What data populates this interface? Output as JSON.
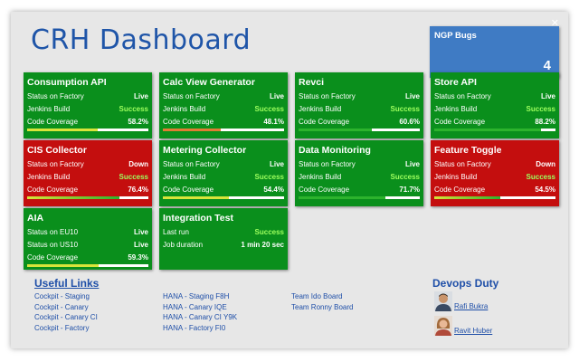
{
  "title": "CRH Dashboard",
  "close_label": "✕",
  "ngp_bugs": {
    "label": "NGP Bugs",
    "count": "4"
  },
  "cards": [
    {
      "title": "Consumption API",
      "color": "green",
      "rows": [
        [
          "Status on Factory",
          "Live"
        ],
        [
          "Jenkins Build",
          "Success"
        ],
        [
          "Code Coverage",
          "58.2%"
        ]
      ],
      "coverage": 58.2
    },
    {
      "title": "Calc View Generator",
      "color": "green",
      "rows": [
        [
          "Status on Factory",
          "Live"
        ],
        [
          "Jenkins Build",
          "Success"
        ],
        [
          "Code Coverage",
          "48.1%"
        ]
      ],
      "coverage": 48.1
    },
    {
      "title": "Revci",
      "color": "green",
      "rows": [
        [
          "Status on Factory",
          "Live"
        ],
        [
          "Jenkins Build",
          "Success"
        ],
        [
          "Code Coverage",
          "60.6%"
        ]
      ],
      "coverage": 60.6
    },
    {
      "title": "Store API",
      "color": "green",
      "rows": [
        [
          "Status on Factory",
          "Live"
        ],
        [
          "Jenkins Build",
          "Success"
        ],
        [
          "Code Coverage",
          "88.2%"
        ]
      ],
      "coverage": 88.2
    },
    {
      "title": "CIS Collector",
      "color": "red",
      "rows": [
        [
          "Status on Factory",
          "Down"
        ],
        [
          "Jenkins Build",
          "Success"
        ],
        [
          "Code Coverage",
          "76.4%"
        ]
      ],
      "coverage": 76.4
    },
    {
      "title": "Metering Collector",
      "color": "green",
      "rows": [
        [
          "Status on Factory",
          "Live"
        ],
        [
          "Jenkins Build",
          "Success"
        ],
        [
          "Code Coverage",
          "54.4%"
        ]
      ],
      "coverage": 54.4
    },
    {
      "title": "Data Monitoring",
      "color": "green",
      "rows": [
        [
          "Status on Factory",
          "Live"
        ],
        [
          "Jenkins Build",
          "Success"
        ],
        [
          "Code Coverage",
          "71.7%"
        ]
      ],
      "coverage": 71.7
    },
    {
      "title": "Feature Toggle",
      "color": "red",
      "rows": [
        [
          "Status on Factory",
          "Down"
        ],
        [
          "Jenkins Build",
          "Success"
        ],
        [
          "Code Coverage",
          "54.5%"
        ]
      ],
      "coverage": 54.5
    },
    {
      "title": "AIA",
      "color": "green",
      "rows": [
        [
          "Status on EU10",
          "Live"
        ],
        [
          "Status on US10",
          "Live"
        ],
        [
          "Code Coverage",
          "59.3%"
        ]
      ],
      "coverage": 59.3
    },
    {
      "title": "Integration Test",
      "color": "green",
      "rows": [
        [
          "Last run",
          "Success"
        ],
        [
          "Job duration",
          "1 min 20 sec"
        ]
      ],
      "coverage": null
    }
  ],
  "useful_links": {
    "heading": "Useful Links",
    "columns": [
      [
        "Cockpit - Staging",
        "Cockpit - Canary",
        "Cockpit - Canary CI",
        "Cockpit - Factory"
      ],
      [
        "HANA - Staging F8H",
        "HANA - Canary IQE",
        "HANA - Canary CI Y9K",
        "HANA - Factory FI0"
      ],
      [
        "Team Ido Board",
        "Team Ronny Board"
      ]
    ]
  },
  "devops": {
    "heading": "Devops Duty",
    "people": [
      {
        "name": "Rafi Bukra",
        "avatar": "male-avatar"
      },
      {
        "name": "Ravit Huber",
        "avatar": "female-avatar"
      }
    ]
  },
  "colors": {
    "green_card": "#0a8f1c",
    "red_card": "#c40e0e",
    "title_blue": "#1f55a8",
    "bugs_blue": "#3f7bc4",
    "success_text": "#9dff5e",
    "bar_green": "#2db32d",
    "bar_yellow": "#d8e43a",
    "bar_orange": "#e07d35"
  }
}
